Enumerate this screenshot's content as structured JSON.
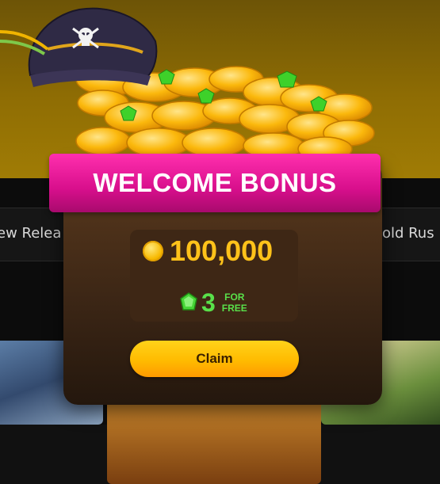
{
  "background": {
    "nav_left_label": "ew Relea",
    "nav_right_label": "Gold Rus"
  },
  "popup": {
    "title": "WELCOME BONUS",
    "coin_amount": "100,000",
    "gem_amount": "3",
    "gem_label_line1": "FOR",
    "gem_label_line2": "FREE",
    "claim_label": "Claim"
  },
  "icons": {
    "coin": "coin-icon",
    "gem": "gem-icon",
    "pirate_hat": "pirate-hat-icon"
  },
  "colors": {
    "ribbon": "#e0158f",
    "coin_text": "#ffc21a",
    "gem_text": "#59e04a",
    "button": "#ffbb00"
  }
}
